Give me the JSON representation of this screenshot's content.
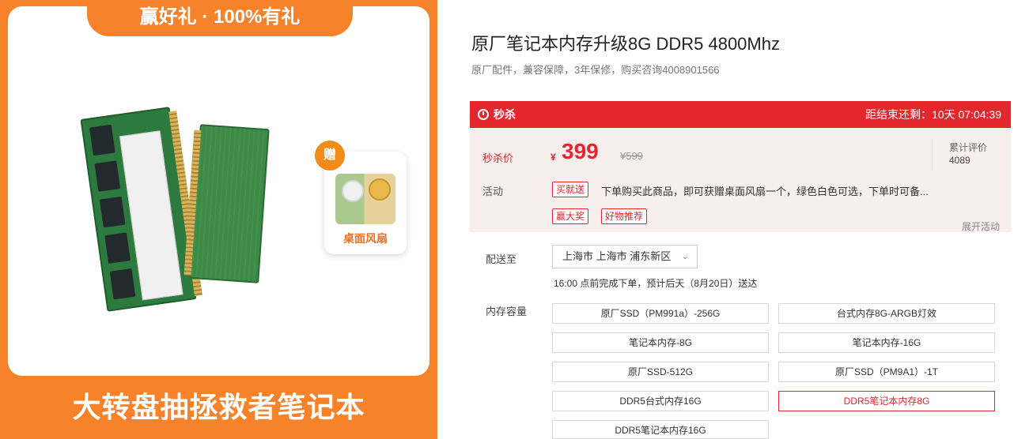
{
  "promo": {
    "top_banner": "赢好礼 · 100%有礼",
    "bottom_banner": "大转盘抽拯救者笔记本",
    "gift_badge": "赠",
    "gift_label": "桌面风扇"
  },
  "product": {
    "title": "原厂笔记本内存升级8G DDR5 4800Mhz",
    "subtitle": "原厂配件，兼容保障，3年保修，购买咨询4008901566"
  },
  "flash_sale": {
    "label": "秒杀",
    "countdown": "距结束还剩：10天 07:04:39"
  },
  "price": {
    "label": "秒杀价",
    "currency": "¥",
    "current": "399",
    "original": "¥599",
    "review_label": "累计评价",
    "review_count": "4089"
  },
  "activity": {
    "label": "活动",
    "tags": [
      "买就送",
      "赢大奖",
      "好物推荐"
    ],
    "text": "下单购买此商品，即可获赠桌面风扇一个，绿色白色可选，下单时可备...",
    "expand": "展开活动"
  },
  "shipping": {
    "label": "配送至",
    "address": "上海市  上海市  浦东新区",
    "delivery": "16:00 点前完成下单，预计后天（8月20日）送达"
  },
  "capacity": {
    "label": "内存容量",
    "options": [
      "原厂SSD（PM991a）-256G",
      "台式内存8G-ARGB灯效",
      "笔记本内存-8G",
      "笔记本内存-16G",
      "原厂SSD-512G",
      "原厂SSD（PM9A1）-1T",
      "DDR5台式内存16G",
      "DDR5笔记本内存8G",
      "DDR5笔记本内存16G"
    ],
    "selected": "DDR5笔记本内存8G"
  },
  "colors": {
    "accent_red": "#e4262d",
    "promo_orange": "#f6822a"
  }
}
